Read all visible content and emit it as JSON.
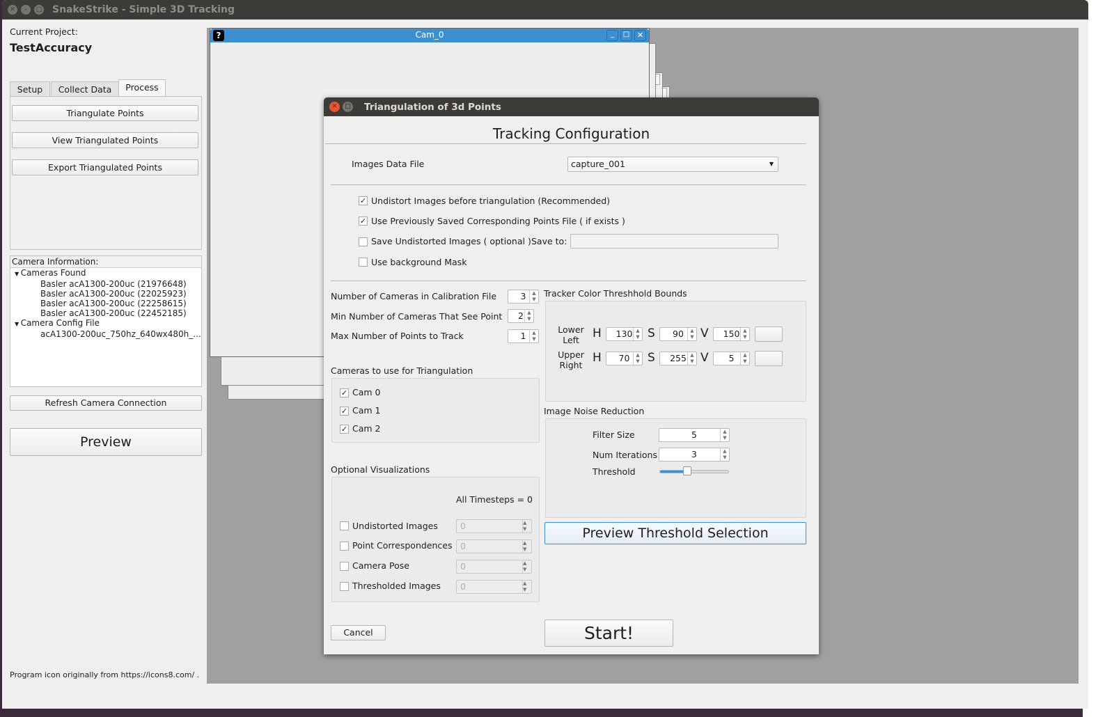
{
  "app": {
    "title": "SnakeStrike - Simple 3D Tracking"
  },
  "left": {
    "project_label": "Current Project:",
    "project_name": "TestAccuracy",
    "tabs": [
      "Setup",
      "Collect Data",
      "Process"
    ],
    "active_tab": "Process",
    "buttons": [
      "Triangulate Points",
      "View Triangulated Points",
      "Export Triangulated Points"
    ],
    "camera_info_label": "Camera Information:",
    "tree": {
      "cameras_found": "Cameras Found",
      "cameras": [
        "Basler acA1300-200uc (21976648)",
        "Basler acA1300-200uc (22025923)",
        "Basler acA1300-200uc (22258615)",
        "Basler acA1300-200uc (22452185)"
      ],
      "config_label": "Camera Config File",
      "config_file": "acA1300-200uc_750hz_640wx480h_..."
    },
    "refresh": "Refresh Camera Connection",
    "preview": "Preview",
    "footer": "Program icon originally from https://icons8.com/ ."
  },
  "cam_window": {
    "title": "Cam_0"
  },
  "dialog": {
    "title": "Triangulation of 3d Points",
    "heading": "Tracking Configuration",
    "images_label": "Images Data File",
    "images_value": "capture_001",
    "options": [
      {
        "label": "Undistort Images before triangulation (Recommended)",
        "checked": true
      },
      {
        "label": "Use Previously Saved Corresponding Points File ( if exists )",
        "checked": true
      },
      {
        "label": "Save Undistorted Images ( optional )",
        "checked": false
      },
      {
        "label": "Use background Mask",
        "checked": false
      }
    ],
    "save_to_label": "Save to:",
    "save_to_value": "",
    "num_cameras_label": "Number of Cameras in Calibration File",
    "num_cameras": "3",
    "min_cameras_label": "Min Number of Cameras That See Point",
    "min_cameras": "2",
    "max_points_label": "Max Number of Points to Track",
    "max_points": "1",
    "cams_label": "Cameras to use for Triangulation",
    "cams": [
      {
        "label": "Cam 0",
        "checked": true
      },
      {
        "label": "Cam 1",
        "checked": true
      },
      {
        "label": "Cam 2",
        "checked": true
      }
    ],
    "viz_label": "Optional Visualizations",
    "all_timesteps": "All Timesteps = 0",
    "viz": [
      {
        "label": "Undistorted Images",
        "value": "0"
      },
      {
        "label": "Point Correspondences",
        "value": "0"
      },
      {
        "label": "Camera Pose",
        "value": "0"
      },
      {
        "label": "Thresholded Images",
        "value": "0"
      }
    ],
    "tracker_label": "Tracker Color Threshhold Bounds",
    "lower_label": "Lower Left",
    "upper_label": "Upper Right",
    "h": "H",
    "s": "S",
    "v": "V",
    "lower": {
      "h": "130",
      "s": "90",
      "v": "150"
    },
    "upper": {
      "h": "70",
      "s": "255",
      "v": "5"
    },
    "noise_label": "Image Noise Reduction",
    "filter_label": "Filter Size",
    "filter": "5",
    "iter_label": "Num Iterations",
    "iter": "3",
    "threshold_label": "Threshold",
    "threshold_fraction": 0.4,
    "preview_threshold": "Preview Threshold Selection",
    "cancel": "Cancel",
    "start": "Start!"
  },
  "colors": {
    "titlebar": "#3c3b37",
    "cam_titlebar": "#3d8fd0",
    "mdi_bg": "#a0a0a0",
    "slider": "#3d8fd0"
  }
}
